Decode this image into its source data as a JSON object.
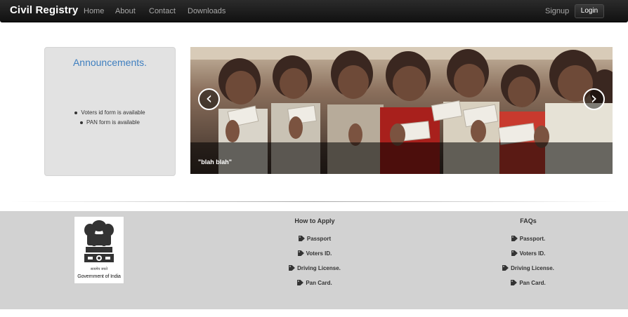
{
  "navbar": {
    "brand": "Civil Registry",
    "links": [
      "Home",
      "About",
      "Contact",
      "Downloads"
    ],
    "signup": "Signup",
    "login": "Login"
  },
  "announcements": {
    "title": "Announcements.",
    "items": [
      "Voters id form is available",
      "PAN form is available"
    ]
  },
  "carousel": {
    "caption": "\"blah blah\"",
    "prev_icon": "‹",
    "next_icon": "›"
  },
  "footer": {
    "emblem_motto": "सत्यमेव जयते",
    "emblem_caption": "Government of India",
    "how_to_apply": {
      "title": "How to Apply",
      "links": [
        "Passport",
        "Voters ID.",
        "Driving License.",
        "Pan Card."
      ]
    },
    "faqs": {
      "title": "FAQs",
      "links": [
        "Passport.",
        "Voters ID.",
        "Driving License.",
        "Pan Card."
      ]
    }
  },
  "icons": {
    "link_icon": "tag-icon"
  }
}
